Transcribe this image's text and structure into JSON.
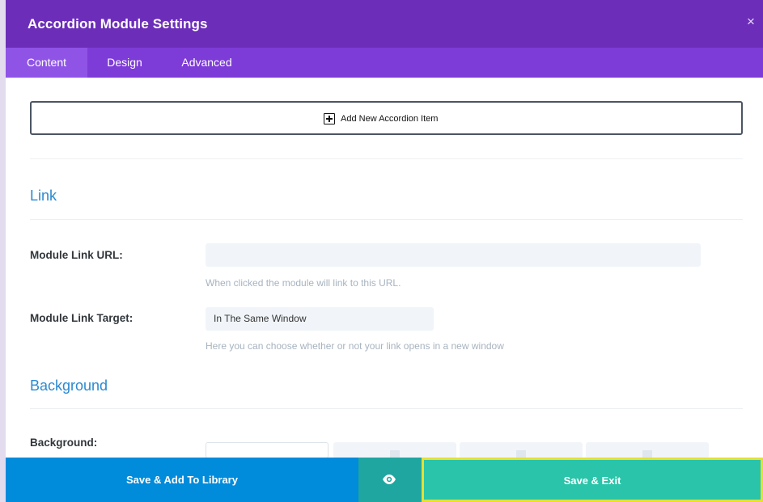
{
  "header": {
    "title": "Accordion Module Settings",
    "close_label": "×"
  },
  "tabs": [
    {
      "label": "Content",
      "active": true
    },
    {
      "label": "Design",
      "active": false
    },
    {
      "label": "Advanced",
      "active": false
    }
  ],
  "content": {
    "add_item_label": "Add New Accordion Item",
    "sections": {
      "link": {
        "title": "Link",
        "module_link_url": {
          "label": "Module Link URL:",
          "value": "",
          "help": "When clicked the module will link to this URL."
        },
        "module_link_target": {
          "label": "Module Link Target:",
          "value": "In The Same Window",
          "help": "Here you can choose whether or not your link opens in a new window"
        }
      },
      "background": {
        "title": "Background",
        "label": "Background:"
      }
    }
  },
  "footer": {
    "save_library_label": "Save & Add To Library",
    "save_exit_label": "Save & Exit"
  },
  "colors": {
    "header": "#6c2eb9",
    "tabs": "#7d3bd7",
    "accent_blue": "#2c8ad0",
    "footer_blue": "#008bdb",
    "footer_teal": "#1fa6a0",
    "footer_green": "#29c4a9",
    "highlight": "#e7df34"
  },
  "icons": {
    "close": "close-icon",
    "add": "plus-square-icon",
    "preview": "eye-icon"
  }
}
